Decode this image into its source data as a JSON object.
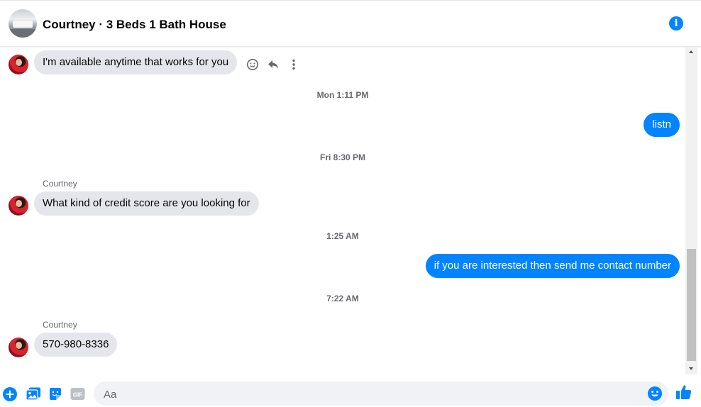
{
  "header": {
    "title": "Courtney · 3 Beds 1 Bath House",
    "info_icon": "info-icon"
  },
  "messages": [
    {
      "type": "incoming",
      "text": "I'm available anytime that works for you"
    },
    {
      "type": "timestamp",
      "text": "Mon 1:11 PM"
    },
    {
      "type": "outgoing",
      "text": "listn"
    },
    {
      "type": "timestamp",
      "text": "Fri 8:30 PM"
    },
    {
      "type": "sender",
      "text": "Courtney"
    },
    {
      "type": "incoming",
      "text": "What kind of credit score are you looking for"
    },
    {
      "type": "timestamp",
      "text": "1:25 AM"
    },
    {
      "type": "outgoing",
      "text": "if you are interested then send me contact number"
    },
    {
      "type": "timestamp",
      "text": "7:22 AM"
    },
    {
      "type": "sender",
      "text": "Courtney"
    },
    {
      "type": "incoming",
      "text": "570-980-8336"
    }
  ],
  "message_actions": [
    "smiley-react-icon",
    "reply-icon",
    "more-options-icon"
  ],
  "composer": {
    "placeholder": "Aa",
    "icons": [
      "plus-icon",
      "photo-icon",
      "sticker-icon",
      "gif-icon",
      "emoji-icon",
      "thumbs-up-icon"
    ],
    "gif_label": "GIF"
  },
  "colors": {
    "accent": "#0084ff",
    "incoming_bubble": "#e4e6eb",
    "secondary_text": "#65676b"
  }
}
